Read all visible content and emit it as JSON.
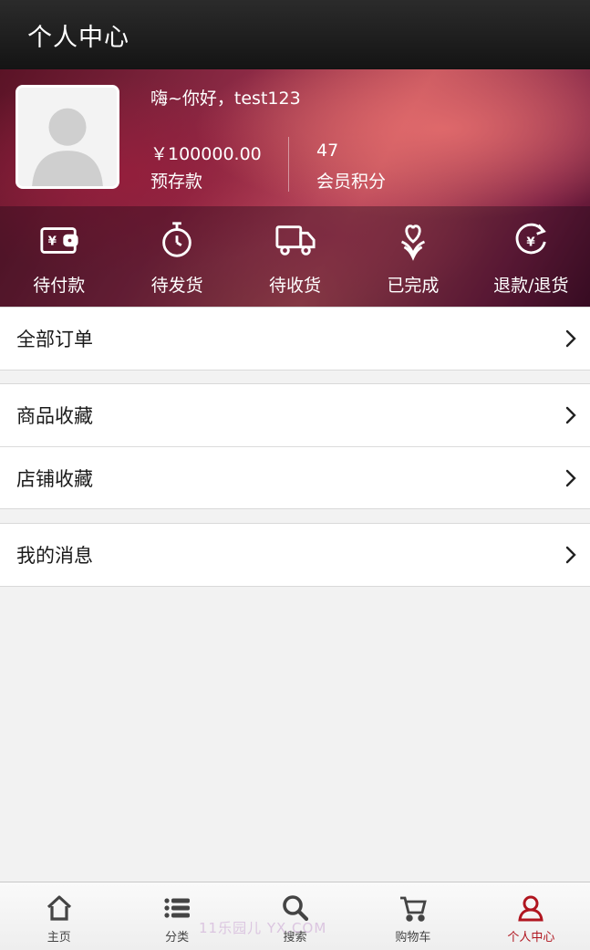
{
  "header": {
    "title": "个人中心"
  },
  "profile": {
    "greeting": "嗨~你好，test123",
    "balance_value": "￥100000.00",
    "balance_label": "预存款",
    "points_value": "47",
    "points_label": "会员积分"
  },
  "orders": [
    {
      "label": "待付款",
      "icon": "wallet-icon"
    },
    {
      "label": "待发货",
      "icon": "stopwatch-icon"
    },
    {
      "label": "待收货",
      "icon": "truck-icon"
    },
    {
      "label": "已完成",
      "icon": "heart-flower-icon"
    },
    {
      "label": "退款/退货",
      "icon": "refund-icon"
    }
  ],
  "menu": {
    "all_orders": "全部订单",
    "product_favorites": "商品收藏",
    "store_favorites": "店铺收藏",
    "my_messages": "我的消息"
  },
  "tabbar": {
    "items": [
      {
        "label": "主页",
        "icon": "home-icon"
      },
      {
        "label": "分类",
        "icon": "list-icon"
      },
      {
        "label": "搜索",
        "icon": "search-icon"
      },
      {
        "label": "购物车",
        "icon": "cart-icon"
      },
      {
        "label": "个人中心",
        "icon": "user-icon"
      }
    ],
    "active_index": 4
  },
  "watermark": "11乐园儿    YX.COM",
  "colors": {
    "accent": "#b0151f",
    "header_bg": "#1c1c1c"
  }
}
